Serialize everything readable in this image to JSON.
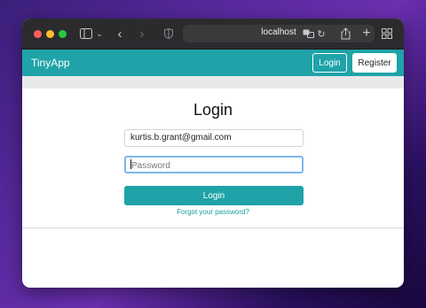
{
  "browser": {
    "url": "localhost"
  },
  "app": {
    "brand": "TinyApp",
    "nav": {
      "login_label": "Login",
      "register_label": "Register"
    }
  },
  "login_form": {
    "title": "Login",
    "email_value": "kurtis.b.grant@gmail.com",
    "password_placeholder": "Password",
    "submit_label": "Login",
    "forgot_link": "Forgot your password?"
  },
  "colors": {
    "accent": "#1fa3a8",
    "titlebar": "#2b2b2e",
    "focus_ring": "#7eb6ec"
  }
}
